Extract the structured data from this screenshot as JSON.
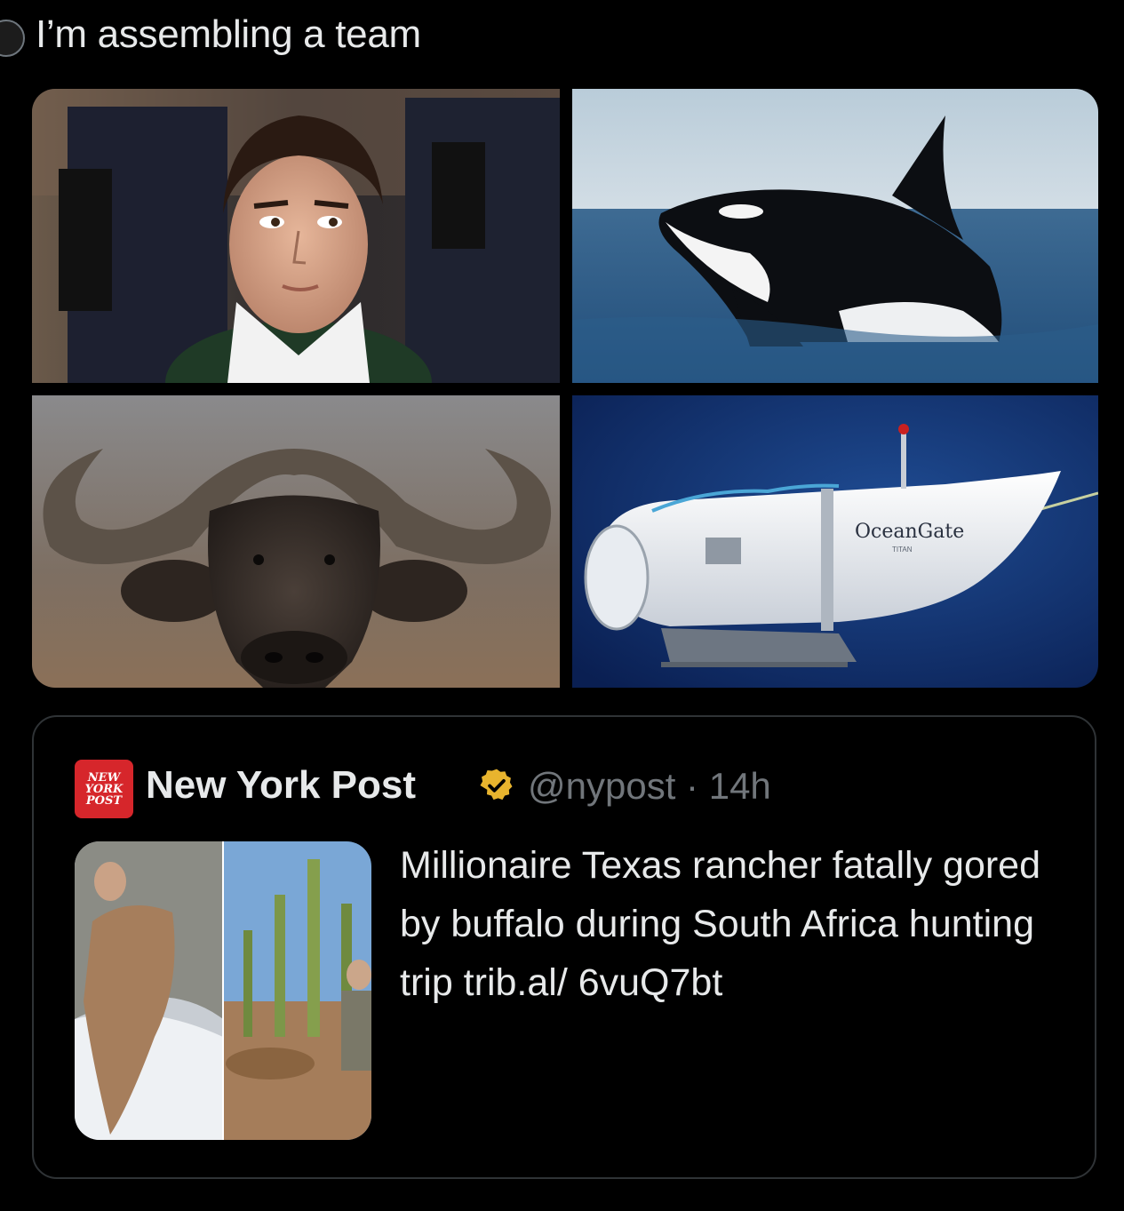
{
  "tweet": {
    "text": "I’m assembling a team"
  },
  "media": [
    {
      "name": "man-photo"
    },
    {
      "name": "orca-photo"
    },
    {
      "name": "buffalo-photo"
    },
    {
      "name": "submarine-photo",
      "submarine_logo": "OceanGate",
      "submarine_sublabel": "TITAN"
    }
  ],
  "quote": {
    "logo_lines": [
      "NEW",
      "YORK",
      "POST"
    ],
    "author_name": "New York Post",
    "verified_icon": "verified-badge-icon",
    "handle_time": "@nypost · 14h",
    "text": "Millionaire Texas rancher fatally gored by buffalo during South Africa hunting trip trib.al/ 6vuQ7bt"
  },
  "colors": {
    "background": "#000000",
    "text_primary": "#e7e9ea",
    "text_secondary": "#71767b",
    "border": "#2f3336",
    "verified_gold": "#e8b42e",
    "nypost_red": "#d6262b"
  }
}
